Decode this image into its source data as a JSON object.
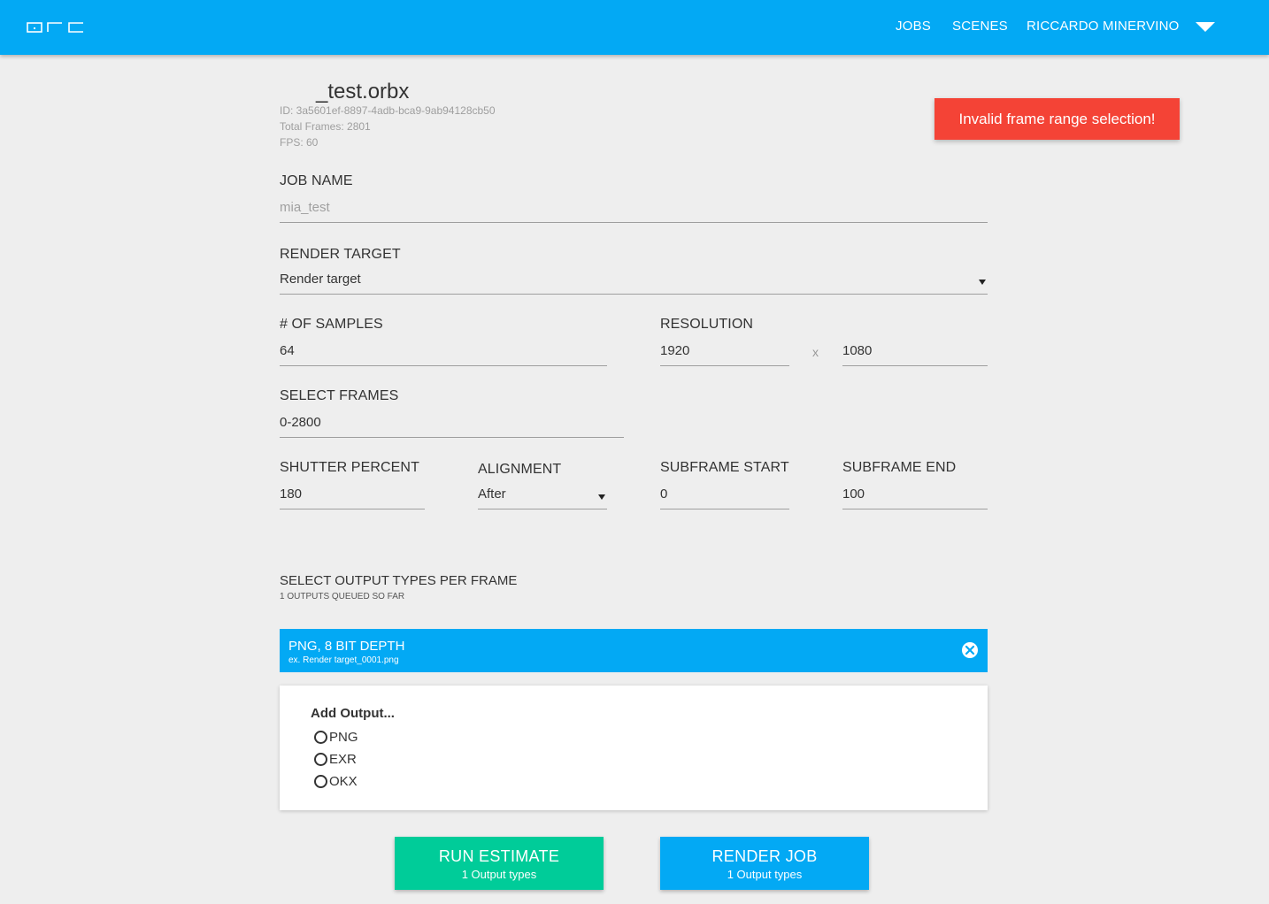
{
  "header": {
    "logo_name": "arc-logo",
    "nav": {
      "jobs": "JOBS",
      "scenes": "SCENES",
      "user": "RICCARDO MINERVINO"
    },
    "brand_color": "#03a9f4"
  },
  "scene": {
    "title": "_test.orbx",
    "id_line": "ID: 3a5601ef-8897-4adb-bca9-9ab94128cb50",
    "total_frames_line": "Total Frames: 2801",
    "fps_line": "FPS: 60"
  },
  "toast": {
    "message": "Invalid frame range selection!",
    "color": "#f44336"
  },
  "form": {
    "job_name": {
      "label": "JOB NAME",
      "placeholder": "mia_test"
    },
    "render_target": {
      "label": "RENDER TARGET",
      "value": "Render target"
    },
    "samples": {
      "label": "# OF SAMPLES",
      "value": "64"
    },
    "resolution": {
      "label": "RESOLUTION",
      "width": "1920",
      "separator": "x",
      "height": "1080"
    },
    "frames": {
      "label": "SELECT FRAMES",
      "value": "0-2800"
    },
    "shutter": {
      "label": "SHUTTER PERCENT",
      "value": "180"
    },
    "alignment": {
      "label": "ALIGNMENT",
      "value": "After"
    },
    "subframe_start": {
      "label": "SUBFRAME START",
      "value": "0"
    },
    "subframe_end": {
      "label": "SUBFRAME END",
      "value": "100"
    }
  },
  "outputs": {
    "title": "SELECT OUTPUT TYPES PER FRAME",
    "subtitle": "1 OUTPUTS QUEUED SO FAR",
    "queued": [
      {
        "name": "PNG, 8 BIT DEPTH",
        "example": "ex. Render target_0001.png"
      }
    ],
    "add_title": "Add Output...",
    "options": [
      "PNG",
      "EXR",
      "OKX"
    ]
  },
  "actions": {
    "estimate": {
      "label": "RUN ESTIMATE",
      "sub": "1 Output types",
      "color": "#00cc99"
    },
    "render": {
      "label": "RENDER JOB",
      "sub": "1 Output types",
      "color": "#03a9f4"
    }
  }
}
